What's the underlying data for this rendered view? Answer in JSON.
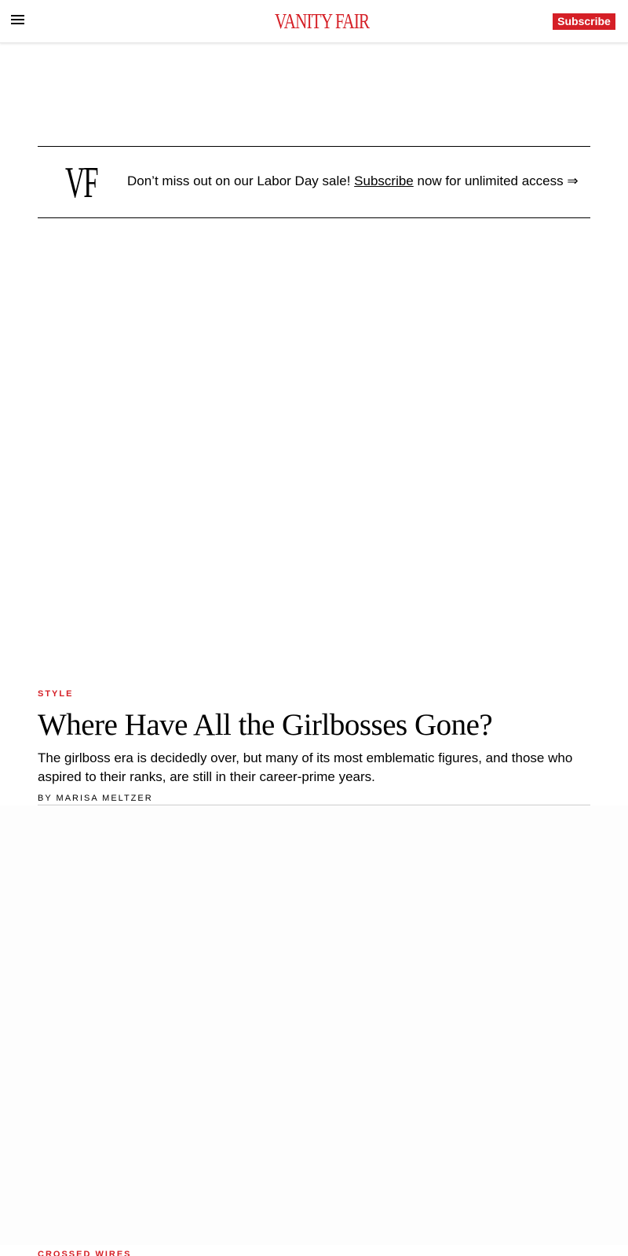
{
  "header": {
    "logo": "VANITY FAIR",
    "subscribe_label": "Subscribe"
  },
  "promo": {
    "mark": "VF",
    "text_before": "Don’t miss out on our Labor Day sale! ",
    "link_label": "Subscribe",
    "text_after": " now for unlimited access ⇒"
  },
  "article": {
    "section": "STYLE",
    "title": "Where Have All the Girlbosses Gone?",
    "dek": "The girlboss era is decidedly over, but many of its most emblematic figures, and those who aspired to their ranks, are still in their career-prime years.",
    "byline_prefix": "BY ",
    "author": "MARISA MELTZER"
  },
  "next_article": {
    "section": "CROSSED WIRES"
  },
  "colors": {
    "brand_red": "#d51f26"
  }
}
